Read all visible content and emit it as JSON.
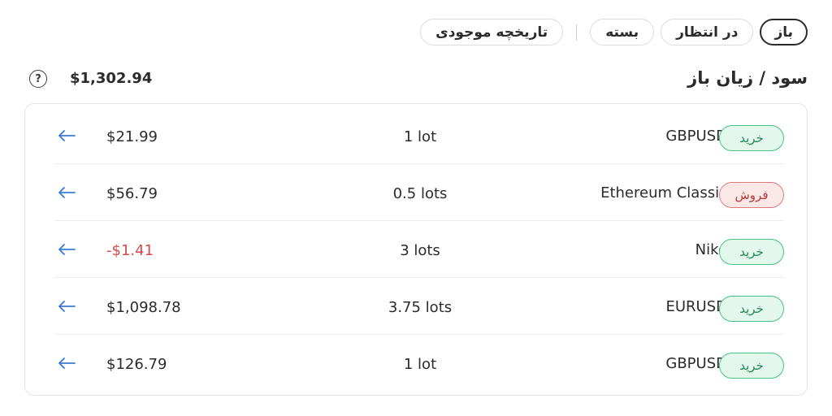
{
  "tabs": [
    {
      "label": "باز",
      "active": true
    },
    {
      "label": "در انتظار",
      "active": false
    },
    {
      "label": "بسته",
      "active": false
    },
    {
      "label": "تاریخچه موجودی",
      "active": false
    }
  ],
  "summary": {
    "title": "سود / زیان باز",
    "value": "$1,302.94",
    "help_icon": "?"
  },
  "positions": [
    {
      "side": "خرید",
      "side_type": "buy",
      "symbol": "GBPUSD",
      "lots": "1 lot",
      "pnl": "$21.99",
      "negative": false
    },
    {
      "side": "فروش",
      "side_type": "sell",
      "symbol": "Ethereum Classic",
      "lots": "0.5 lots",
      "pnl": "$56.79",
      "negative": false
    },
    {
      "side": "خرید",
      "side_type": "buy",
      "symbol": "Nike",
      "lots": "3 lots",
      "pnl": "-$1.41",
      "negative": true
    },
    {
      "side": "خرید",
      "side_type": "buy",
      "symbol": "EURUSD",
      "lots": "3.75 lots",
      "pnl": "$1,098.78",
      "negative": false
    },
    {
      "side": "خرید",
      "side_type": "buy",
      "symbol": "GBPUSD",
      "lots": "1 lot",
      "pnl": "$126.79",
      "negative": false
    }
  ],
  "colors": {
    "buy_border": "#48c386",
    "buy_bg": "#e4f7ec",
    "sell_border": "#e07a7a",
    "sell_bg": "#fde8e8",
    "negative": "#d24a4a",
    "arrow": "#3a7bd5"
  },
  "icons": {
    "row_action": "arrow-left-icon",
    "help": "question-circle-icon"
  }
}
